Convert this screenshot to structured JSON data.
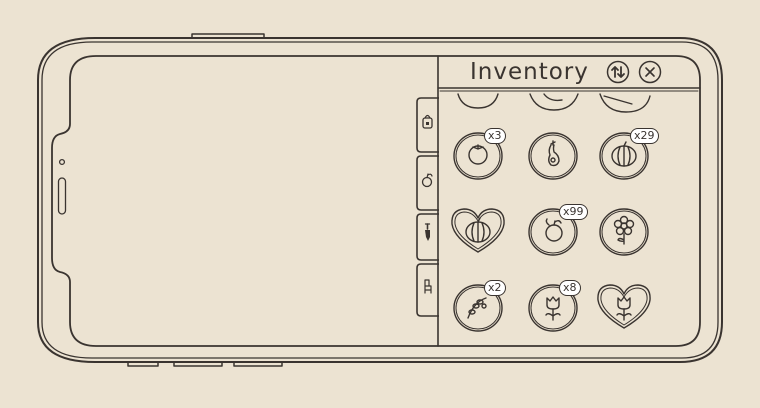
{
  "panel": {
    "title": "Inventory",
    "sort_icon": "sort-arrows-icon",
    "close_icon": "close-icon"
  },
  "tabs": [
    {
      "name": "tab-bag",
      "icon": "bag-icon",
      "active": false
    },
    {
      "name": "tab-fruit",
      "icon": "apple-icon",
      "active": true
    },
    {
      "name": "tab-tools",
      "icon": "shovel-icon",
      "active": false
    },
    {
      "name": "tab-furniture",
      "icon": "chair-icon",
      "active": false
    }
  ],
  "items": [
    {
      "icon": "tomato-icon",
      "frame": "circle",
      "qty": "x3"
    },
    {
      "icon": "eggplant-icon",
      "frame": "circle",
      "qty": ""
    },
    {
      "icon": "pumpkin-icon",
      "frame": "circle",
      "qty": "x29"
    },
    {
      "icon": "pumpkin-icon",
      "frame": "heart",
      "qty": ""
    },
    {
      "icon": "apple-icon",
      "frame": "circle",
      "qty": "x99"
    },
    {
      "icon": "flower-icon",
      "frame": "circle",
      "qty": ""
    },
    {
      "icon": "seeds-icon",
      "frame": "circle",
      "qty": "x2"
    },
    {
      "icon": "tulip-icon",
      "frame": "circle",
      "qty": "x8"
    },
    {
      "icon": "tulip-icon",
      "frame": "heart",
      "qty": ""
    }
  ]
}
